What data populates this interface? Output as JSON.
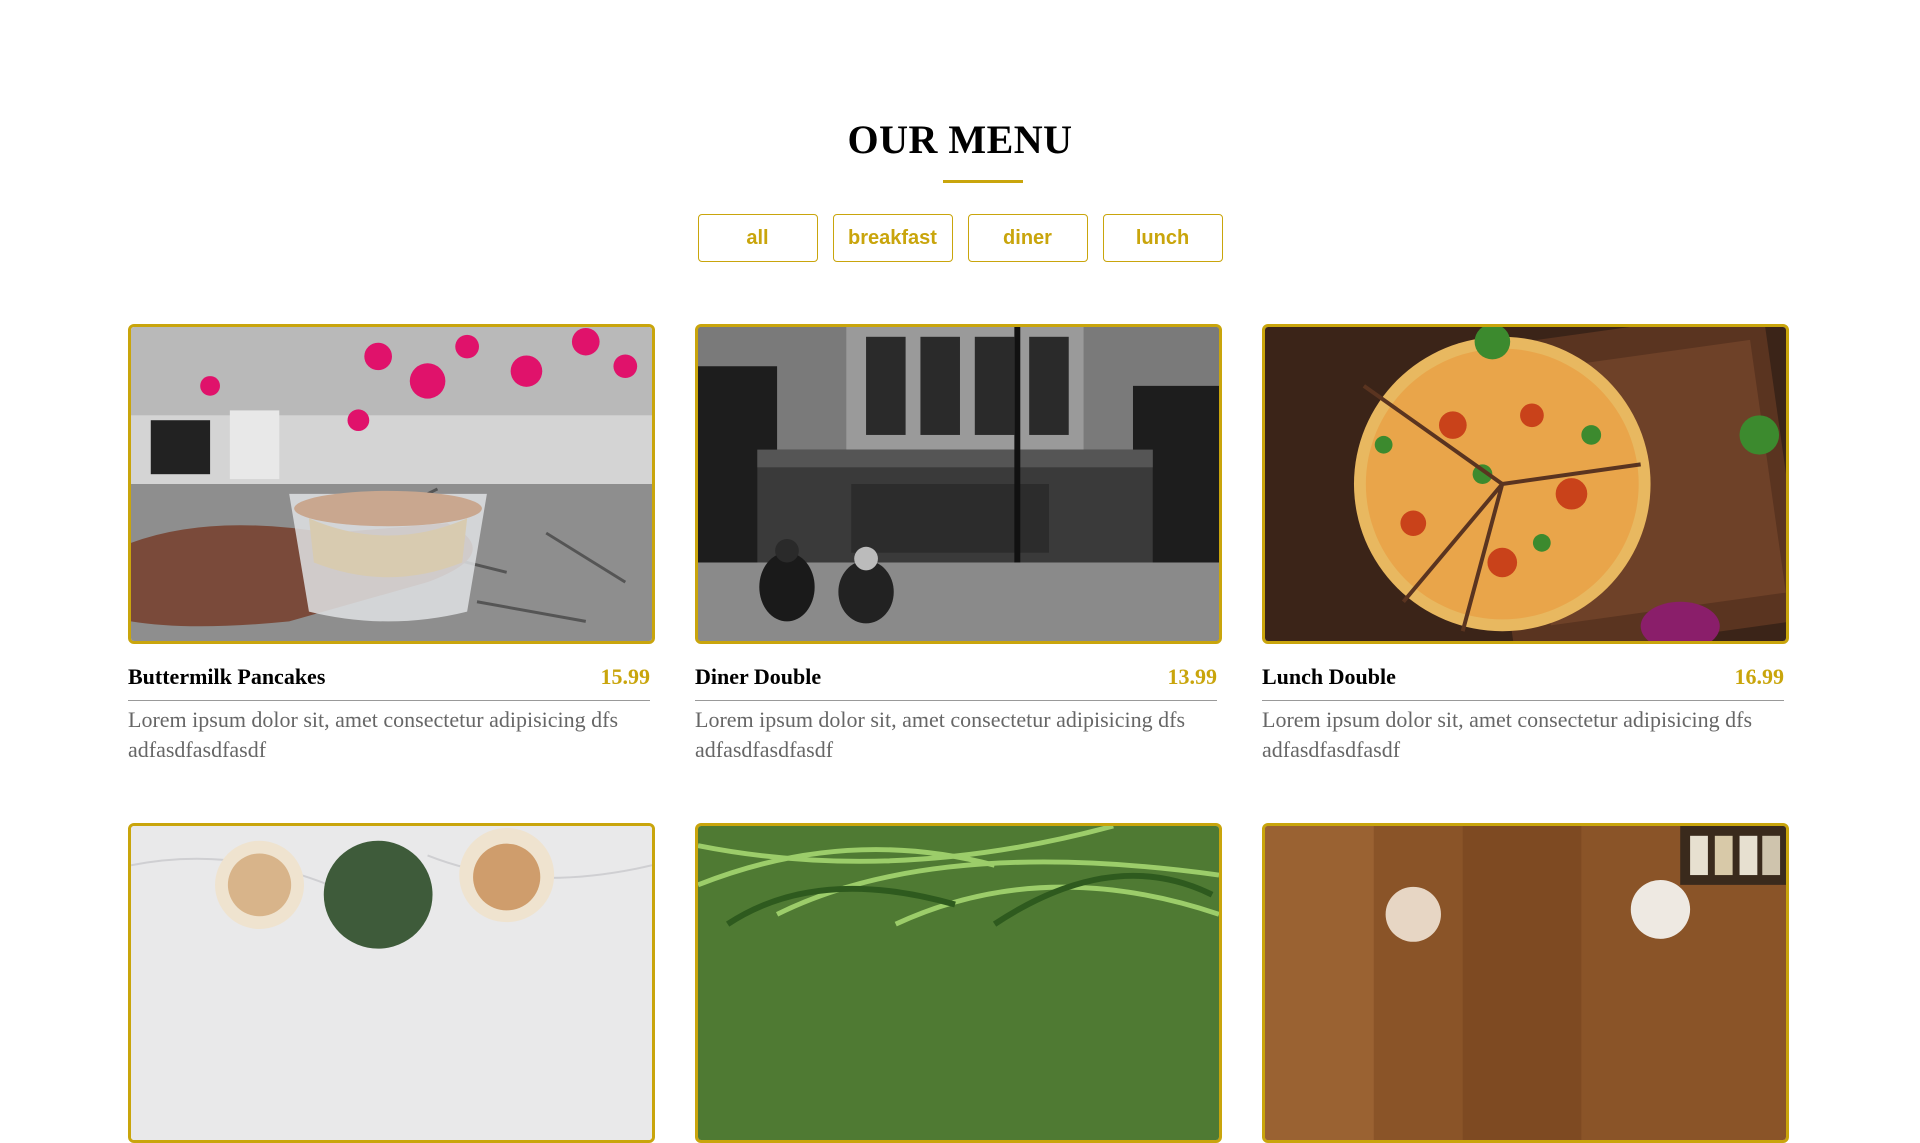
{
  "section": {
    "title": "OUR MENU",
    "accent_color": "#c9a50c"
  },
  "filters": [
    {
      "label": "all"
    },
    {
      "label": "breakfast"
    },
    {
      "label": "diner"
    },
    {
      "label": "lunch"
    }
  ],
  "menu": [
    {
      "name": "Buttermilk Pancakes",
      "price": "15.99",
      "desc": "Lorem ipsum dolor sit, amet consectetur adipisicing dfs adfasdfasdfasdf",
      "photo_icon": "dessert-cup-photo"
    },
    {
      "name": "Diner Double",
      "price": "13.99",
      "desc": "Lorem ipsum dolor sit, amet consectetur adipisicing dfs adfasdfasdfasdf",
      "photo_icon": "memorial-photo"
    },
    {
      "name": "Lunch Double",
      "price": "16.99",
      "desc": "Lorem ipsum dolor sit, amet consectetur adipisicing dfs adfasdfasdfasdf",
      "photo_icon": "pizza-photo"
    },
    {
      "photo_icon": "ice-cream-photo"
    },
    {
      "photo_icon": "grass-photo"
    },
    {
      "photo_icon": "people-photo"
    }
  ]
}
